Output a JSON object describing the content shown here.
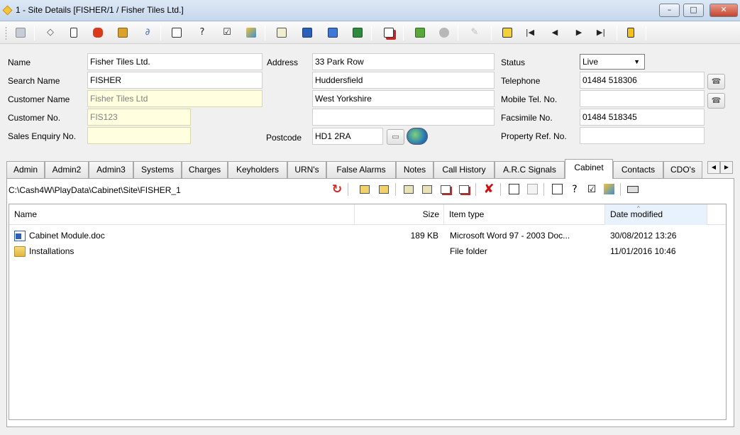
{
  "window": {
    "title": "1 - Site Details [FISHER/1 / Fisher Tiles Ltd.]",
    "min": "–",
    "max": "□",
    "close": "✕"
  },
  "toolbar": {
    "icons": [
      "save-icon",
      "eraser-icon",
      "copy-icon",
      "phone-icon",
      "briefcase-icon",
      "paperclip-icon",
      "notepad-icon",
      "help-icon",
      "checklist-icon",
      "pencil-icon",
      "print-preview-icon",
      "word-icon",
      "word-alt-icon",
      "excel-icon",
      "export-icon",
      "spreadsheet-icon",
      "fingerprint-icon",
      "disabled-edit-icon",
      "stack-icon",
      "first-record-icon",
      "previous-record-icon",
      "next-record-icon",
      "last-record-icon",
      "exit-icon"
    ],
    "nav": {
      "first": "|◀",
      "prev": "◀",
      "next": "▶",
      "last": "▶|"
    }
  },
  "form": {
    "name_label": "Name",
    "name_value": "Fisher Tiles Ltd.",
    "search_name_label": "Search Name",
    "search_name_value": "FISHER",
    "customer_name_label": "Customer Name",
    "customer_name_value": "Fisher Tiles Ltd",
    "customer_no_label": "Customer No.",
    "customer_no_value": "FIS123",
    "sales_enquiry_label": "Sales Enquiry No.",
    "sales_enquiry_value": "",
    "address_label": "Address",
    "address_lines": [
      "33 Park Row",
      "Huddersfield",
      "West Yorkshire",
      ""
    ],
    "postcode_label": "Postcode",
    "postcode_value": "HD1 2RA",
    "status_label": "Status",
    "status_value": "Live",
    "telephone_label": "Telephone",
    "telephone_value": "01484 518306",
    "mobile_label": "Mobile Tel. No.",
    "mobile_value": "",
    "fax_label": "Facsimile No.",
    "fax_value": "01484 518345",
    "property_ref_label": "Property Ref. No.",
    "property_ref_value": ""
  },
  "tabs": [
    "Admin",
    "Admin2",
    "Admin3",
    "Systems",
    "Charges",
    "Keyholders",
    "URN's",
    "False Alarms",
    "Notes",
    "Call History",
    "A.R.C Signals",
    "Cabinet",
    "Contacts",
    "CDO's"
  ],
  "active_tab": "Cabinet",
  "cabinet": {
    "path": "C:\\Cash4W\\PlayData\\Cabinet\\Site\\FISHER_1",
    "columns": {
      "name": "Name",
      "size": "Size",
      "type": "Item type",
      "modified": "Date modified"
    },
    "files": [
      {
        "name": "Cabinet Module.doc",
        "size": "189 KB",
        "type": "Microsoft Word 97 - 2003 Doc...",
        "modified": "30/08/2012 13:26",
        "icon": "word-document-icon"
      },
      {
        "name": "Installations",
        "size": "",
        "type": "File folder",
        "modified": "11/01/2016 10:46",
        "icon": "folder-icon"
      }
    ]
  },
  "colors": {
    "accent": "#dde8f5",
    "required_field": "#ffffe0",
    "refresh": "#e02020",
    "delete": "#cc1111"
  }
}
